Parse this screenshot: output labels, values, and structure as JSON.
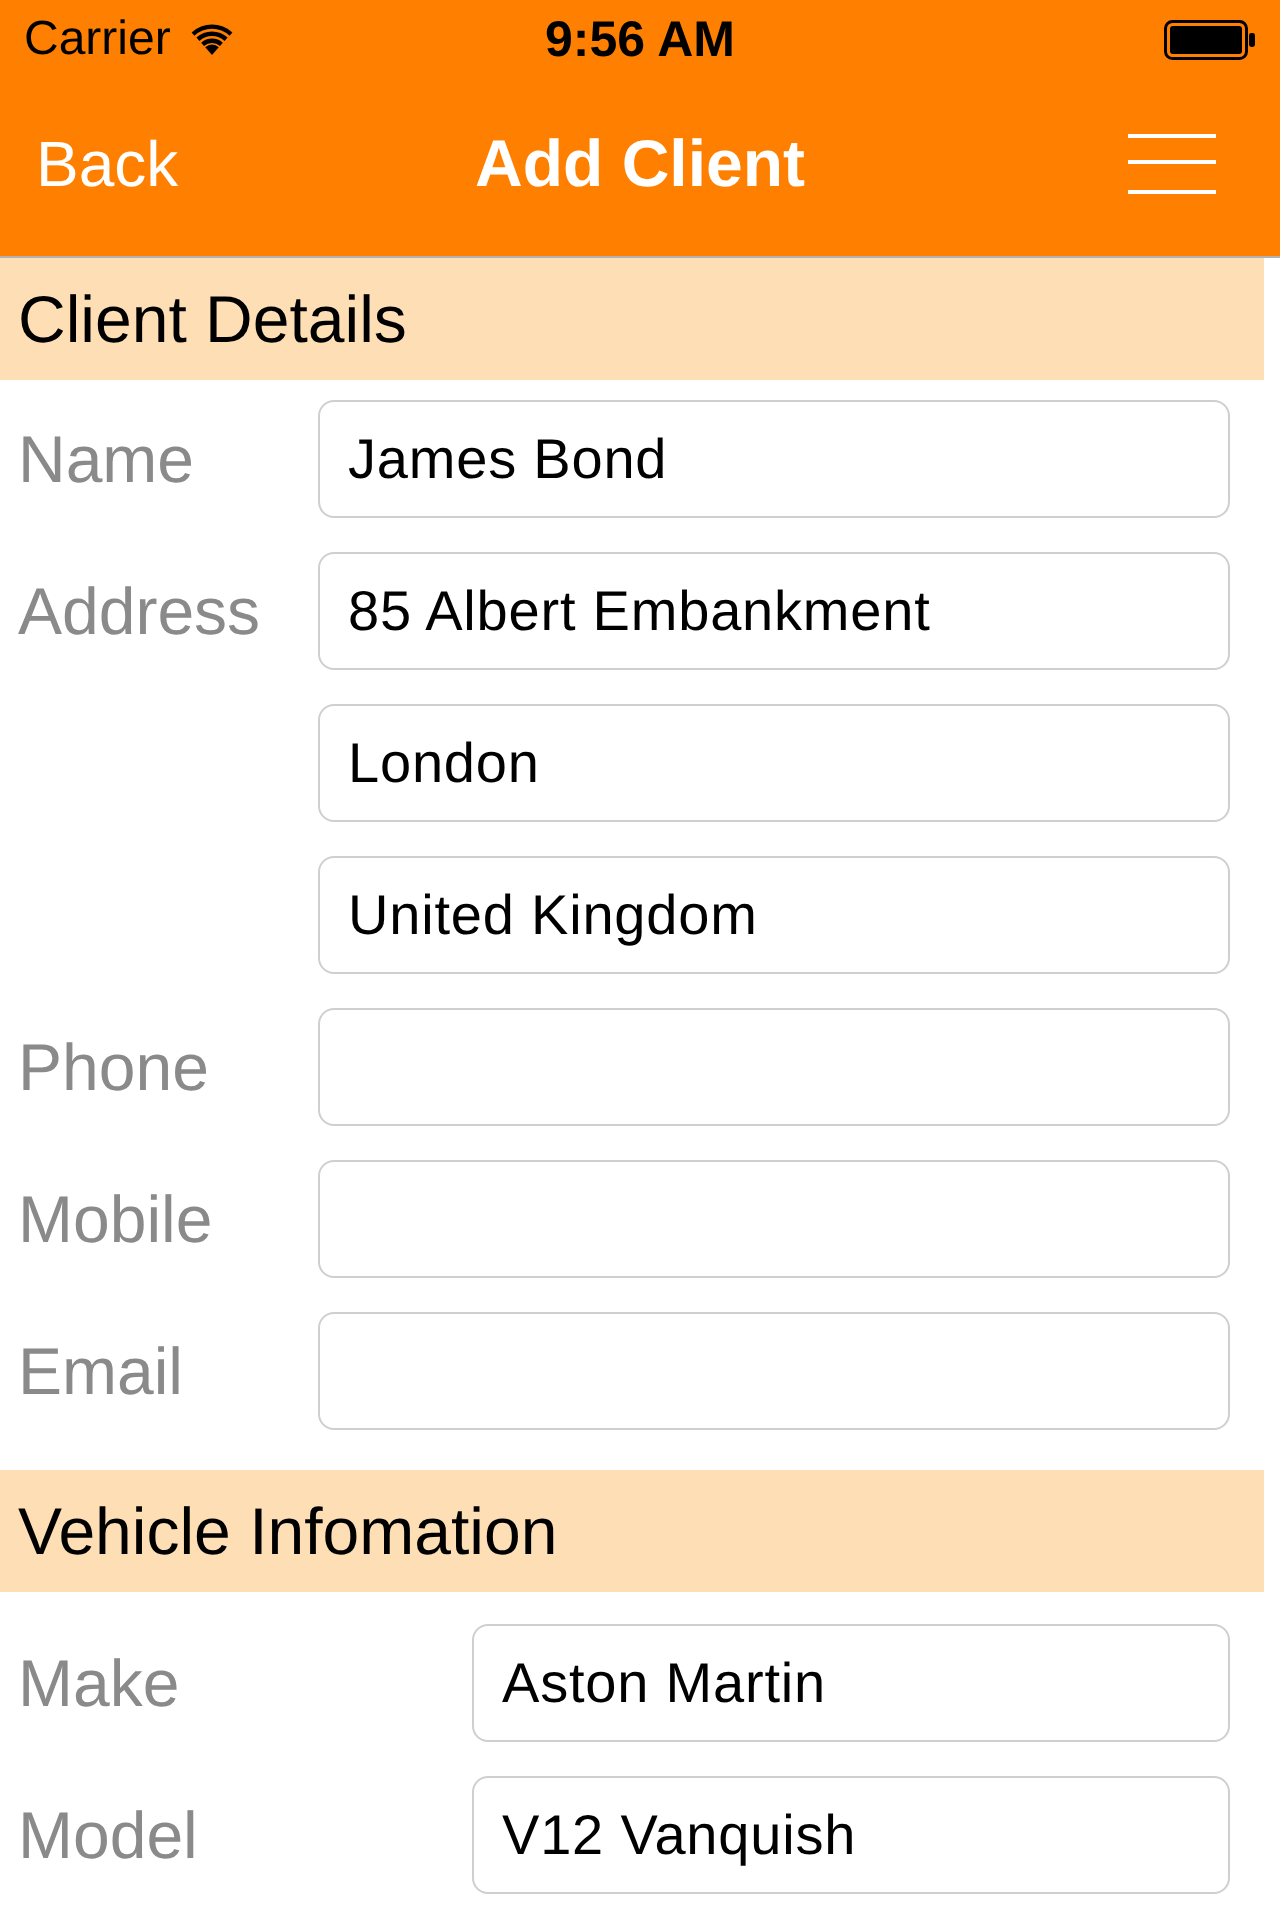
{
  "status_bar": {
    "carrier": "Carrier",
    "time": "9:56 AM"
  },
  "nav_bar": {
    "back": "Back",
    "title": "Add Client"
  },
  "sections": [
    {
      "title": "Client Details",
      "rows": [
        {
          "label": "Name",
          "fields": [
            {
              "value": "James Bond"
            }
          ]
        },
        {
          "label": "Address",
          "fields": [
            {
              "value": "85 Albert Embankment"
            },
            {
              "value": "London"
            },
            {
              "value": "United Kingdom"
            }
          ]
        },
        {
          "label": "Phone"
        },
        {
          "label": "Mobile"
        },
        {
          "label": "Email"
        }
      ]
    },
    {
      "title": "Vehicle Infomation",
      "rows": [
        {
          "label": "Make",
          "fields": [
            {
              "value": "Aston Martin"
            }
          ]
        },
        {
          "label": "Model",
          "fields": [
            {
              "value": "V12 Vanquish"
            }
          ]
        }
      ]
    }
  ]
}
